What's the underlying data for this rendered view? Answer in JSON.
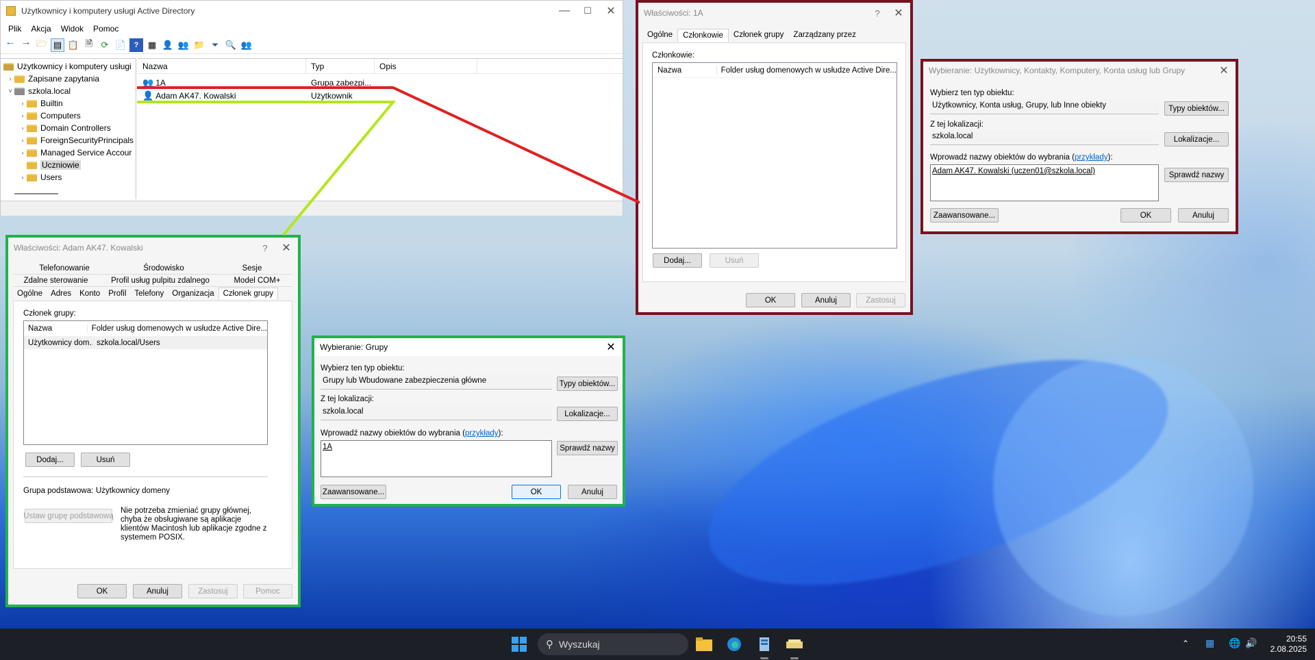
{
  "aduc": {
    "title": "Użytkownicy i komputery usługi Active Directory",
    "menu": [
      "Plik",
      "Akcja",
      "Widok",
      "Pomoc"
    ],
    "tree": [
      {
        "label": "Użytkownicy i komputery usługi",
        "level": 0,
        "exp": ""
      },
      {
        "label": "Zapisane zapytania",
        "level": 1,
        "exp": "›"
      },
      {
        "label": "szkola.local",
        "level": 1,
        "exp": "˅"
      },
      {
        "label": "Builtin",
        "level": 2,
        "exp": "›"
      },
      {
        "label": "Computers",
        "level": 2,
        "exp": "›"
      },
      {
        "label": "Domain Controllers",
        "level": 2,
        "exp": "›"
      },
      {
        "label": "ForeignSecurityPrincipals",
        "level": 2,
        "exp": "›"
      },
      {
        "label": "Managed Service Accour",
        "level": 2,
        "exp": "›"
      },
      {
        "label": "Uczniowie",
        "level": 2,
        "exp": "",
        "selected": true
      },
      {
        "label": "Users",
        "level": 2,
        "exp": "›"
      }
    ],
    "columns": [
      "Nazwa",
      "Typ",
      "Opis"
    ],
    "rows": [
      {
        "name": "1A",
        "type": "Grupa zabezpi..."
      },
      {
        "name": "Adam AK47. Kowalski",
        "type": "Użytkownik"
      }
    ]
  },
  "props_1a": {
    "title": "Właściwości: 1A",
    "tabs": [
      "Ogólne",
      "Członkowie",
      "Członek grupy",
      "Zarządzany przez"
    ],
    "members_label": "Członkowie:",
    "col_name": "Nazwa",
    "col_desc": "Folder usług domenowych w usłudze Active Dire...",
    "add": "Dodaj...",
    "remove": "Usuń",
    "ok": "OK",
    "cancel": "Anuluj",
    "apply": "Zastosuj"
  },
  "select_users": {
    "title": "Wybieranie: Użytkownicy, Kontakty, Komputery, Konta usług lub Grupy",
    "type_label": "Wybierz ten typ obiektu:",
    "type_value": "Użytkownicy, Konta usług, Grupy, lub Inne obiekty",
    "types_btn": "Typy obiektów...",
    "loc_label": "Z tej lokalizacji:",
    "loc_value": "szkola.local",
    "loc_btn": "Lokalizacje...",
    "names_label": "Wprowadź nazwy obiektów do wybrania (",
    "names_link": "przykłady",
    "names_label_end": "):",
    "names_value": "Adam AK47. Kowalski (uczen01@szkola.local)",
    "check_btn": "Sprawdź nazwy",
    "advanced": "Zaawansowane...",
    "ok": "OK",
    "cancel": "Anuluj"
  },
  "props_adam": {
    "title": "Właściwości: Adam AK47. Kowalski",
    "tabs_row1": [
      "Telefonowanie",
      "Środowisko",
      "Sesje"
    ],
    "tabs_row2": [
      "Zdalne sterowanie",
      "Profil usług pulpitu zdalnego",
      "Model COM+"
    ],
    "tabs_row3": [
      "Ogólne",
      "Adres",
      "Konto",
      "Profil",
      "Telefony",
      "Organizacja",
      "Członek grupy"
    ],
    "member_of_label": "Członek grupy:",
    "col_name": "Nazwa",
    "col_desc": "Folder usług domenowych w usłudze Active Dire...",
    "row_name": "Użytkownicy dom...",
    "row_desc": "szkola.local/Users",
    "add": "Dodaj...",
    "remove": "Usuń",
    "primary_label": "Grupa podstawowa:",
    "primary_value": "Użytkownicy domeny",
    "set_primary": "Ustaw grupę podstawową",
    "note": "Nie potrzeba zmieniać grupy głównej, chyba że obsługiwane są aplikacje klientów Macintosh lub aplikacje zgodne z systemem POSIX.",
    "ok": "OK",
    "cancel": "Anuluj",
    "apply": "Zastosuj",
    "help": "Pomoc"
  },
  "select_groups": {
    "title": "Wybieranie: Grupy",
    "type_label": "Wybierz ten typ obiektu:",
    "type_value": "Grupy lub Wbudowane zabezpieczenia główne",
    "types_btn": "Typy obiektów...",
    "loc_label": "Z tej lokalizacji:",
    "loc_value": "szkola.local",
    "loc_btn": "Lokalizacje...",
    "names_label": "Wprowadź nazwy obiektów do wybrania (",
    "names_link": "przykłady",
    "names_label_end": "):",
    "names_value": "1A",
    "check_btn": "Sprawdź nazwy",
    "advanced": "Zaawansowane...",
    "ok": "OK",
    "cancel": "Anuluj"
  },
  "taskbar": {
    "search_placeholder": "Wyszukaj",
    "time": "20:55",
    "date": "2.08.2025"
  },
  "colors": {
    "red_frame": "#7a1020",
    "green_frame": "#22b14c",
    "red_line": "#e02020",
    "yellowgreen_line": "#b5e61d"
  }
}
